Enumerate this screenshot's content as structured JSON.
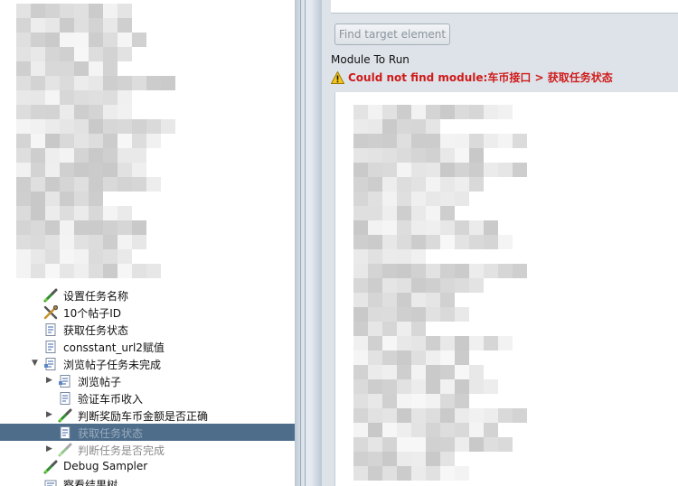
{
  "colors": {
    "accent": "#4d6d8b",
    "error": "#d01a1a",
    "right_bg": "#dde3e9"
  },
  "tree": {
    "items": [
      {
        "label": "设置任务名称",
        "icon": "pipette-icon",
        "expander": "",
        "state": "normal"
      },
      {
        "label": "10个帖子ID",
        "icon": "tools-icon",
        "expander": "",
        "state": "normal"
      },
      {
        "label": "获取任务状态",
        "icon": "sampler-page-icon",
        "expander": "",
        "state": "normal"
      },
      {
        "label": "consstant_url2赋值",
        "icon": "sampler-page-icon",
        "expander": "",
        "state": "normal"
      },
      {
        "label": "浏览帖子任务未完成",
        "icon": "controller-page-icon",
        "expander": "▼",
        "state": "normal"
      },
      {
        "label": "浏览帖子",
        "icon": "controller-page-icon",
        "expander": "▶",
        "state": "normal"
      },
      {
        "label": "验证车币收入",
        "icon": "sampler-page-icon",
        "expander": "",
        "state": "normal"
      },
      {
        "label": "判断奖励车币金额是否正确",
        "icon": "pipette-icon",
        "expander": "▶",
        "state": "normal"
      },
      {
        "label": "获取任务状态",
        "icon": "sampler-page-icon",
        "expander": "",
        "state": "selected"
      },
      {
        "label": "判断任务是否完成",
        "icon": "pipette-icon",
        "expander": "▶",
        "state": "disabled"
      },
      {
        "label": "Debug Sampler",
        "icon": "pipette-icon",
        "expander": "",
        "state": "normal"
      },
      {
        "label": "察看结果树",
        "icon": "listener-icon",
        "expander": "",
        "state": "normal"
      }
    ]
  },
  "right": {
    "find_button_label": "Find target element",
    "module_label": "Module To Run",
    "error_text": "Could not find module:车币接口 > 获取任务状态",
    "error_icon": "warning-icon"
  }
}
